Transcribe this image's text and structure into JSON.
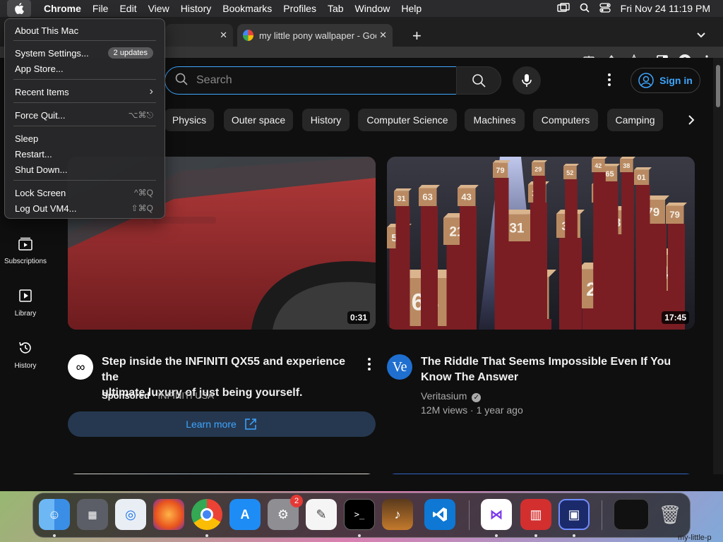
{
  "menubar": {
    "app": "Chrome",
    "items": [
      "File",
      "Edit",
      "View",
      "History",
      "Bookmarks",
      "Profiles",
      "Tab",
      "Window",
      "Help"
    ],
    "datetime": "Fri Nov 24  11:19 PM"
  },
  "apple_menu": {
    "items": [
      {
        "label": "About This Mac"
      },
      {
        "label": "System Settings...",
        "badge": "2 updates"
      },
      {
        "label": "App Store..."
      },
      {
        "label": "Recent Items",
        "submenu": "›"
      },
      {
        "label": "Force Quit...",
        "shortcut": "⌥⌘⎋"
      },
      {
        "label": "Sleep"
      },
      {
        "label": "Restart..."
      },
      {
        "label": "Shut Down..."
      },
      {
        "label": "Lock Screen",
        "shortcut": "^⌘Q"
      },
      {
        "label": "Log Out VM4...",
        "shortcut": "⇧⌘Q"
      }
    ]
  },
  "browser": {
    "tab_active_title": "my little pony wallpaper - Goo",
    "tab_close": "✕",
    "new_tab": "+"
  },
  "youtube": {
    "search_placeholder": "Search",
    "sign_in": "Sign in",
    "chips": [
      "Physics",
      "Outer space",
      "History",
      "Computer Science",
      "Machines",
      "Computers",
      "Camping"
    ],
    "sidebar": [
      {
        "label": "Subscriptions"
      },
      {
        "label": "Library"
      },
      {
        "label": "History"
      }
    ],
    "videos": [
      {
        "title_line1": "Step inside the INFINITI QX55 and experience the",
        "title_line2": "ultimate luxury of just being yourself.",
        "sponsored": "Sponsored",
        "channel": "· INFINITI USA",
        "duration": "0:31",
        "cta": "Learn more",
        "avatar": "∞"
      },
      {
        "title_line1": "The Riddle That Seems Impossible Even If You",
        "title_line2": "Know The Answer",
        "channel": "Veritasium",
        "stats": "12M views · 1 year ago",
        "duration": "17:45",
        "avatar": "Ve",
        "box_numbers": [
          "64",
          "29",
          "27",
          "34",
          "21",
          "31",
          "33",
          "43",
          "79",
          "56",
          "63",
          "43",
          "79",
          "34",
          "79",
          "65",
          "01",
          "31",
          "79",
          "29",
          "52",
          "42",
          "38"
        ]
      }
    ]
  },
  "dock": {
    "settings_badge": "2",
    "right_label": "my-little-p"
  },
  "colors": {
    "accent_blue": "#3ea6ff",
    "yt_bg": "#0f0f0f",
    "chip_bg": "#272727"
  }
}
